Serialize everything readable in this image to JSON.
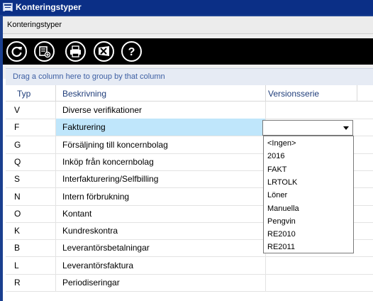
{
  "window": {
    "title": "Konteringstyper"
  },
  "panel": {
    "header": "Konteringstyper"
  },
  "toolbar": {
    "buttons": [
      {
        "icon": "refresh-icon"
      },
      {
        "icon": "new-record-icon"
      },
      {
        "icon": "print-icon"
      },
      {
        "icon": "export-excel-icon"
      },
      {
        "icon": "help-icon"
      }
    ]
  },
  "group_panel": {
    "hint": "Drag a column here to group by that column"
  },
  "grid": {
    "columns": [
      "Typ",
      "Beskrivning",
      "Versionsserie"
    ],
    "rows": [
      {
        "typ": "V",
        "beskrivning": "Diverse verifikationer"
      },
      {
        "typ": "F",
        "beskrivning": "Fakturering"
      },
      {
        "typ": "G",
        "beskrivning": "Försäljning till koncernbolag"
      },
      {
        "typ": "Q",
        "beskrivning": "Inköp från koncernbolag"
      },
      {
        "typ": "S",
        "beskrivning": "Interfakturering/Selfbilling"
      },
      {
        "typ": "N",
        "beskrivning": "Intern förbrukning"
      },
      {
        "typ": "O",
        "beskrivning": "Kontant"
      },
      {
        "typ": "K",
        "beskrivning": "Kundreskontra"
      },
      {
        "typ": "B",
        "beskrivning": "Leverantörsbetalningar"
      },
      {
        "typ": "L",
        "beskrivning": "Leverantörsfaktura"
      },
      {
        "typ": "R",
        "beskrivning": "Periodiseringar"
      }
    ],
    "selected_row_index": 1
  },
  "versionsserie_dropdown": {
    "value": "",
    "options": [
      "<Ingen>",
      "2016",
      "FAKT",
      "LRTOLK",
      "Löner",
      "Manuella",
      "Pengvin",
      "RE2010",
      "RE2011"
    ]
  },
  "colors": {
    "title_bar": "#0b2f86",
    "selected_row": "#bfe6fb",
    "header_text": "#1f3d7a",
    "group_hint": "#3d5fa3"
  }
}
